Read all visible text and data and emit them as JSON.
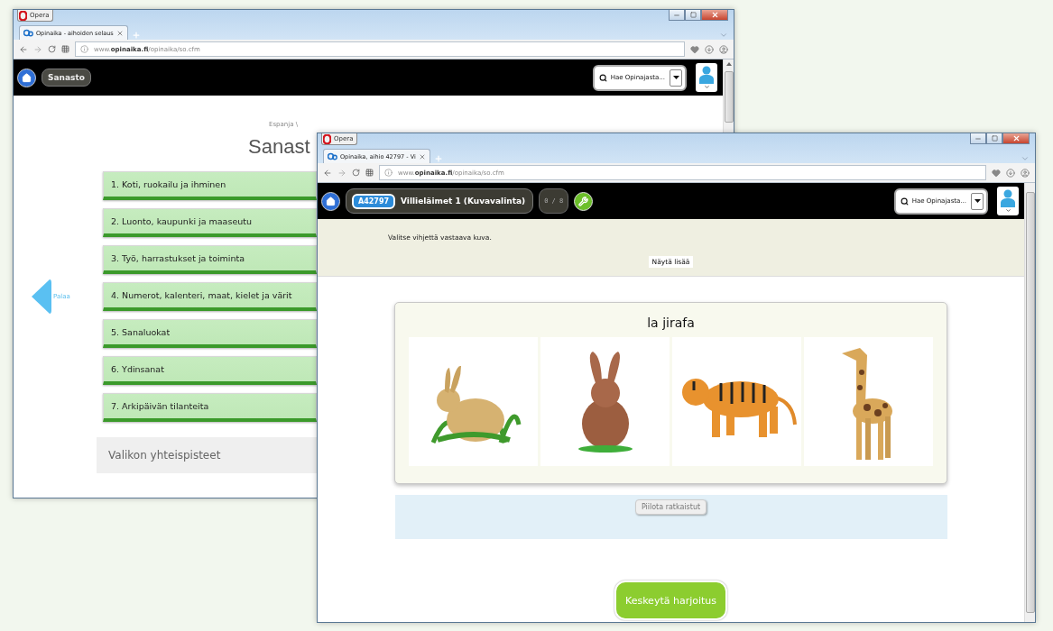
{
  "back_window": {
    "menu_label": "Opera",
    "tab_title": "Opinaika - aihoiden selaus",
    "address": "www.**opinaika.fi**/opinaika/so.cfm",
    "header": {
      "crumb": "Sanasto",
      "search_label": "Hae Opinajasta..."
    },
    "page": {
      "breadcrumb": "Espanja \\",
      "title": "Sanast",
      "back_link": "Palaa",
      "menu_items": [
        "1. Koti, ruokailu ja ihminen",
        "2. Luonto, kaupunki ja maaseutu",
        "3. Työ, harrastukset ja toiminta",
        "4. Numerot, kalenteri, maat, kielet ja värit",
        "5. Sanaluokat",
        "6. Ydinsanat",
        "7. Arkipäivän tilanteita"
      ],
      "total_label": "Valikon yhteispisteet"
    }
  },
  "front_window": {
    "menu_label": "Opera",
    "tab_title": "Opinaika, aihio 42797 - Vi",
    "address": "www.**opinaika.fi**/opinaika/so.cfm",
    "header": {
      "code": "A42797",
      "title": "Villieläimet 1 (Kuvavalinta)",
      "progress": "0 / 8",
      "search_label": "Hae Opinajasta..."
    },
    "page": {
      "instruction": "Valitse vihjettä vastaava kuva.",
      "show_more": "Näytä lisää",
      "quiz": {
        "prompt": "la jirafa",
        "options": [
          {
            "kind": "rabbit_side"
          },
          {
            "kind": "rabbit_front"
          },
          {
            "kind": "tiger"
          },
          {
            "kind": "giraffe"
          }
        ]
      },
      "hide_button": "Piilota ratkaistut",
      "stop_button": "Keskeytä harjoitus"
    }
  }
}
